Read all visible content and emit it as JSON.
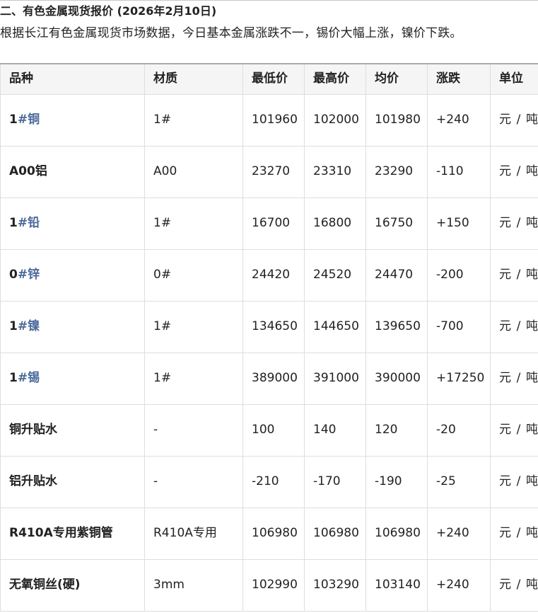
{
  "heading": "二、有色金属现货报价 (2026年2月10日)",
  "summary": "根据长江有色金属现货市场数据，今日基本金属涨跌不一，锡价大幅上涨，镍价下跌。",
  "table": {
    "headers": [
      "品种",
      "材质",
      "最低价",
      "最高价",
      "均价",
      "涨跌",
      "单位"
    ],
    "rows": [
      {
        "prefix": "1",
        "hash": "#",
        "suffix": "铜",
        "material": "1#",
        "low": "101960",
        "high": "102000",
        "avg": "101980",
        "change": "+240",
        "unit": "元/吨"
      },
      {
        "prefix": "A00铝",
        "hash": "",
        "suffix": "",
        "material": "A00",
        "low": "23270",
        "high": "23310",
        "avg": "23290",
        "change": "-110",
        "unit": "元/吨"
      },
      {
        "prefix": "1",
        "hash": "#",
        "suffix": "铅",
        "material": "1#",
        "low": "16700",
        "high": "16800",
        "avg": "16750",
        "change": "+150",
        "unit": "元/吨"
      },
      {
        "prefix": "0",
        "hash": "#",
        "suffix": "锌",
        "material": "0#",
        "low": "24420",
        "high": "24520",
        "avg": "24470",
        "change": "-200",
        "unit": "元/吨"
      },
      {
        "prefix": "1",
        "hash": "#",
        "suffix": "镍",
        "material": "1#",
        "low": "134650",
        "high": "144650",
        "avg": "139650",
        "change": "-700",
        "unit": "元/吨"
      },
      {
        "prefix": "1",
        "hash": "#",
        "suffix": "锡",
        "material": "1#",
        "low": "389000",
        "high": "391000",
        "avg": "390000",
        "change": "+17250",
        "unit": "元/吨"
      },
      {
        "prefix": "铜升贴水",
        "hash": "",
        "suffix": "",
        "material": "-",
        "low": "100",
        "high": "140",
        "avg": "120",
        "change": "-20",
        "unit": "元/吨"
      },
      {
        "prefix": "铝升贴水",
        "hash": "",
        "suffix": "",
        "material": "-",
        "low": "-210",
        "high": "-170",
        "avg": "-190",
        "change": "-25",
        "unit": "元/吨"
      },
      {
        "prefix": "R410A专用紫铜管",
        "hash": "",
        "suffix": "",
        "material": "R410A专用",
        "low": "106980",
        "high": "106980",
        "avg": "106980",
        "change": "+240",
        "unit": "元/吨"
      },
      {
        "prefix": "无氧铜丝(硬)",
        "hash": "",
        "suffix": "",
        "material": "3mm",
        "low": "102990",
        "high": "103290",
        "avg": "103140",
        "change": "+240",
        "unit": "元/吨"
      }
    ]
  }
}
